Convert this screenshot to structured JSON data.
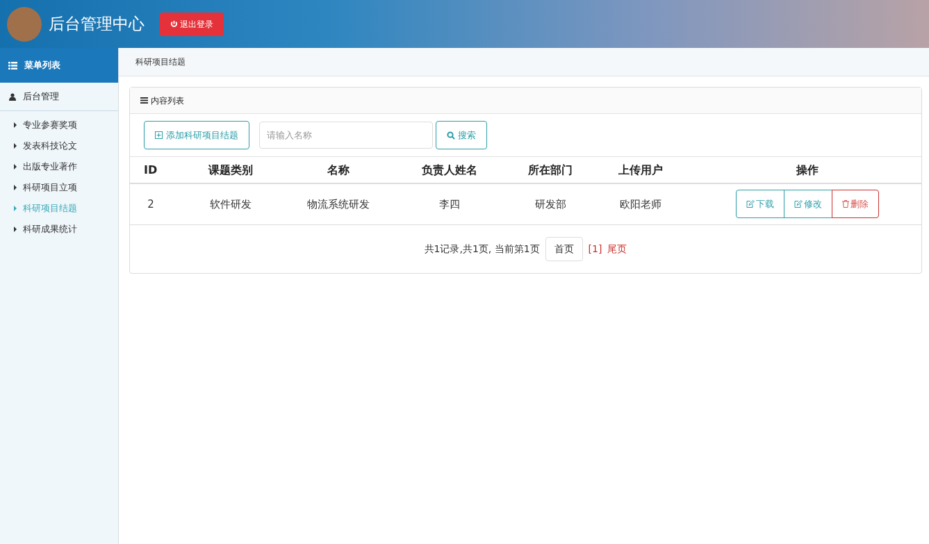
{
  "header": {
    "title": "后台管理中心",
    "logout": "退出登录"
  },
  "sidebar": {
    "heading": "菜单列表",
    "group": "后台管理",
    "items": [
      {
        "label": "专业参赛奖项",
        "selected": false
      },
      {
        "label": "发表科技论文",
        "selected": false
      },
      {
        "label": "出版专业著作",
        "selected": false
      },
      {
        "label": "科研项目立项",
        "selected": false
      },
      {
        "label": "科研项目结题",
        "selected": true
      },
      {
        "label": "科研成果统计",
        "selected": false
      }
    ]
  },
  "breadcrumb": "科研项目结题",
  "panel": {
    "title": "内容列表",
    "add_button": "添加科研项目结题",
    "search": {
      "placeholder": "请输入名称"
    },
    "search_button": "搜索"
  },
  "table": {
    "columns": [
      "ID",
      "课题类别",
      "名称",
      "负责人姓名",
      "所在部门",
      "上传用户",
      "操作"
    ],
    "rows": [
      {
        "cells": [
          "2",
          "软件研发",
          "物流系统研发",
          "李四",
          "研发部",
          "欧阳老师"
        ],
        "actions": [
          {
            "kind": "download",
            "label": "下载"
          },
          {
            "kind": "edit",
            "label": "修改"
          },
          {
            "kind": "delete",
            "label": "删除"
          }
        ]
      }
    ]
  },
  "pagination": {
    "summary": "共1记录,共1页, 当前第1页",
    "first": "首页",
    "current": "[1]",
    "last": "尾页"
  }
}
